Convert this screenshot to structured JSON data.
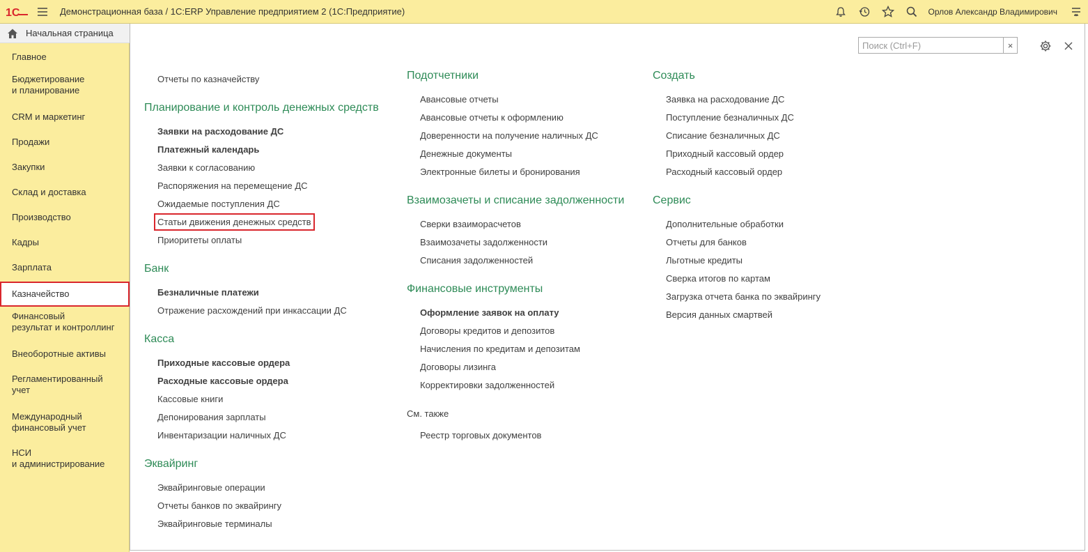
{
  "app": {
    "title": "Демонстрационная база / 1С:ERP Управление предприятием 2  (1С:Предприятие)",
    "logo_text": "1С",
    "user": "Орлов Александр Владимирович"
  },
  "sidebar": {
    "home": "Начальная страница",
    "items": [
      {
        "label": "Главное"
      },
      {
        "label": "Бюджетирование\nи планирование"
      },
      {
        "label": "CRM и маркетинг"
      },
      {
        "label": "Продажи"
      },
      {
        "label": "Закупки"
      },
      {
        "label": "Склад и доставка"
      },
      {
        "label": "Производство"
      },
      {
        "label": "Кадры"
      },
      {
        "label": "Зарплата"
      },
      {
        "label": "Казначейство",
        "active": true
      },
      {
        "label": "Финансовый\nрезультат и контроллинг"
      },
      {
        "label": "Внеоборотные активы"
      },
      {
        "label": "Регламентированный\nучет"
      },
      {
        "label": "Международный\nфинансовый учет"
      },
      {
        "label": "НСИ\nи администрирование"
      }
    ]
  },
  "search": {
    "placeholder": "Поиск (Ctrl+F)",
    "value": "",
    "clear": "×"
  },
  "col1": {
    "reports_link": "Отчеты по казначейству",
    "planning": {
      "title": "Планирование и контроль денежных средств",
      "links": [
        {
          "label": "Заявки на расходование ДС",
          "bold": true
        },
        {
          "label": "Платежный календарь",
          "bold": true
        },
        {
          "label": "Заявки к согласованию"
        },
        {
          "label": "Распоряжения на перемещение ДС"
        },
        {
          "label": "Ожидаемые поступления ДС"
        },
        {
          "label": "Статьи движения денежных средств",
          "highlighted": true
        },
        {
          "label": "Приоритеты оплаты"
        }
      ]
    },
    "bank": {
      "title": "Банк",
      "links": [
        {
          "label": "Безналичные платежи",
          "bold": true
        },
        {
          "label": "Отражение расхождений при инкассации ДС"
        }
      ]
    },
    "cash": {
      "title": "Касса",
      "links": [
        {
          "label": "Приходные кассовые ордера",
          "bold": true
        },
        {
          "label": "Расходные кассовые ордера",
          "bold": true
        },
        {
          "label": "Кассовые книги"
        },
        {
          "label": "Депонирования зарплаты"
        },
        {
          "label": "Инвентаризации наличных ДС"
        }
      ]
    },
    "acquiring": {
      "title": "Эквайринг",
      "links": [
        {
          "label": "Эквайринговые операции"
        },
        {
          "label": "Отчеты банков по эквайрингу"
        },
        {
          "label": "Эквайринговые терминалы"
        }
      ]
    }
  },
  "col2": {
    "accountable": {
      "title": "Подотчетники",
      "links": [
        {
          "label": "Авансовые отчеты"
        },
        {
          "label": "Авансовые отчеты к оформлению"
        },
        {
          "label": "Доверенности на получение наличных ДС"
        },
        {
          "label": "Денежные документы"
        },
        {
          "label": "Электронные билеты и бронирования"
        }
      ]
    },
    "offsets": {
      "title": "Взаимозачеты и списание задолженности",
      "links": [
        {
          "label": "Сверки взаиморасчетов"
        },
        {
          "label": "Взаимозачеты задолженности"
        },
        {
          "label": "Списания задолженностей"
        }
      ]
    },
    "financial": {
      "title": "Финансовые инструменты",
      "links": [
        {
          "label": "Оформление заявок на оплату",
          "bold": true
        },
        {
          "label": "Договоры кредитов и депозитов"
        },
        {
          "label": "Начисления по кредитам и депозитам"
        },
        {
          "label": "Договоры лизинга"
        },
        {
          "label": "Корректировки задолженностей"
        }
      ]
    },
    "see_also": {
      "title": "См. также",
      "links": [
        {
          "label": "Реестр торговых документов"
        }
      ]
    }
  },
  "col3": {
    "create": {
      "title": "Создать",
      "links": [
        {
          "label": "Заявка на расходование ДС"
        },
        {
          "label": "Поступление безналичных ДС"
        },
        {
          "label": "Списание безналичных ДС"
        },
        {
          "label": "Приходный кассовый ордер"
        },
        {
          "label": "Расходный кассовый ордер"
        }
      ]
    },
    "service": {
      "title": "Сервис",
      "links": [
        {
          "label": "Дополнительные обработки"
        },
        {
          "label": "Отчеты для банков"
        },
        {
          "label": "Льготные кредиты"
        },
        {
          "label": "Сверка итогов по картам"
        },
        {
          "label": "Загрузка отчета банка по эквайрингу"
        },
        {
          "label": "Версия данных смартвей"
        }
      ]
    }
  },
  "colors": {
    "accent_green": "#2e8b57",
    "panel_yellow": "#fbed9e",
    "highlight_red": "#d9262c"
  }
}
